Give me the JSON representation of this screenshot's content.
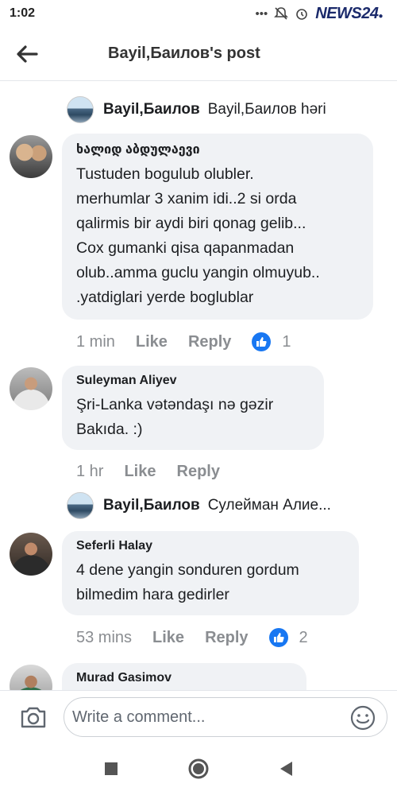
{
  "status": {
    "time": "1:02",
    "brand": "NEWS24",
    "brand_suffix": "●"
  },
  "header": {
    "title": "Bayil,Баилов's post"
  },
  "posts": [
    {
      "type": "share",
      "name": "Bayil,Баилов",
      "text": "Bayil,Баилов həri"
    },
    {
      "type": "comment",
      "author": "ხალიდ აბდულაევი",
      "lines": [
        "Tustuden bogulub olubler.",
        "merhumlar 3 xanim idi..2 si orda",
        "qalirmis bir aydi biri qonag gelib...",
        "Cox gumanki qisa qapanmadan",
        "olub..amma guclu yangin olmuyub..",
        ".yatdiglari yerde boglublar"
      ],
      "time": "1 min",
      "like": "Like",
      "reply": "Reply",
      "reactions": "1"
    },
    {
      "type": "comment",
      "author": "Suleyman  Aliyev",
      "lines": [
        "Şri-Lanka vətəndaşı nə gəzir",
        "Bakıda. :)"
      ],
      "time": "1 hr",
      "like": "Like",
      "reply": "Reply"
    },
    {
      "type": "share",
      "name": "Bayil,Баилов",
      "text": "Сулейман Алие..."
    },
    {
      "type": "comment",
      "author": "Seferli Halay",
      "lines": [
        "4 dene yangin sonduren gordum",
        "bilmedim hara gedirler"
      ],
      "time": "53 mins",
      "like": "Like",
      "reply": "Reply",
      "reactions": "2"
    },
    {
      "type": "comment",
      "author": "Murad Gasimov",
      "lines": []
    }
  ],
  "composer": {
    "placeholder": "Write a comment..."
  },
  "icons": {
    "back": "arrow-left-icon",
    "camera": "camera-icon",
    "emoji": "smiley-icon",
    "like": "thumbs-up-icon"
  },
  "colors": {
    "accent": "#1877f2",
    "bubble": "#f0f2f5",
    "meta": "#8a8d91"
  }
}
